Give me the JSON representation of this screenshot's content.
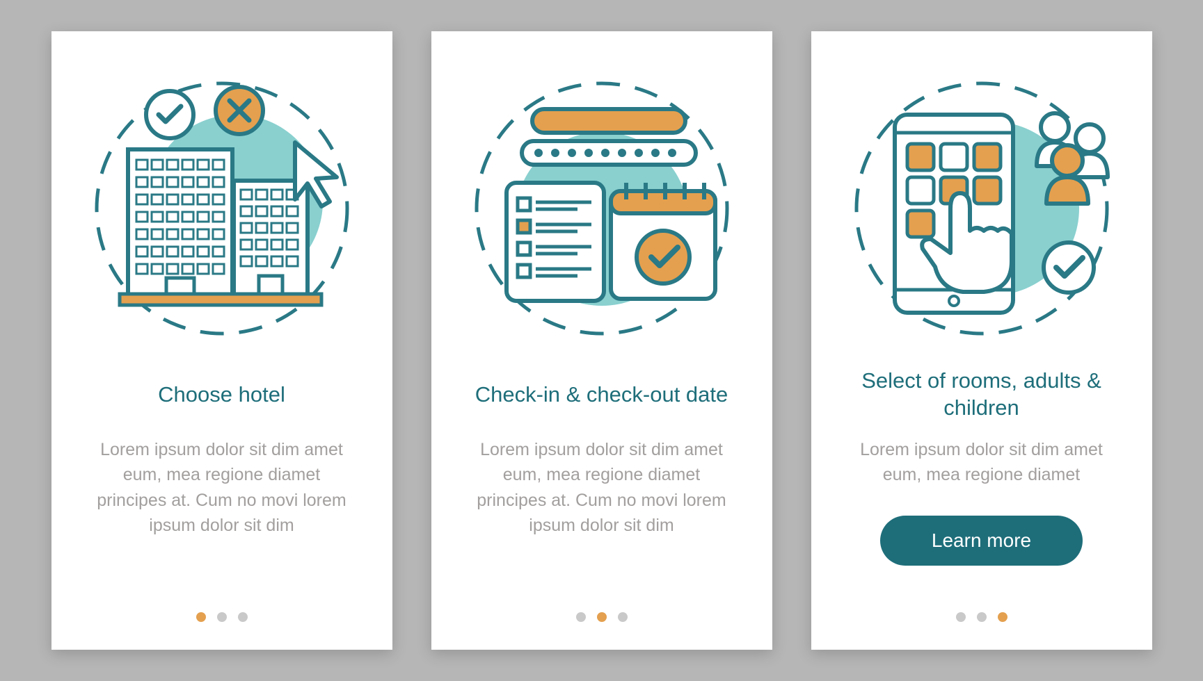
{
  "colors": {
    "background": "#b6b6b6",
    "card": "#ffffff",
    "title": "#1e6e7a",
    "desc": "#a29f9e",
    "cta_bg": "#1e6e7a",
    "cta_text": "#ffffff",
    "dot_inactive": "#c9c9c9",
    "dot_active": "#e4a04f",
    "teal_fill": "#6bc6c5",
    "teal_stroke": "#2a7986",
    "orange_fill": "#e4a04f"
  },
  "screens": [
    {
      "icon": "hotel-choose-icon",
      "title": "Choose hotel",
      "desc": "Lorem ipsum dolor sit dim amet eum, mea regione diamet principes at. Cum no movi lorem ipsum dolor sit dim",
      "dots_active_index": 0,
      "has_button": false
    },
    {
      "icon": "checkin-date-icon",
      "title": "Check-in & check-out date",
      "desc": "Lorem ipsum dolor sit dim amet eum, mea regione diamet principes at. Cum no movi lorem ipsum dolor sit dim",
      "dots_active_index": 1,
      "has_button": false
    },
    {
      "icon": "rooms-guests-icon",
      "title": "Select of rooms, adults & children",
      "desc": "Lorem ipsum dolor sit dim amet eum, mea regione diamet",
      "dots_active_index": 2,
      "has_button": true,
      "button_label": "Learn more"
    }
  ],
  "dot_count": 3
}
